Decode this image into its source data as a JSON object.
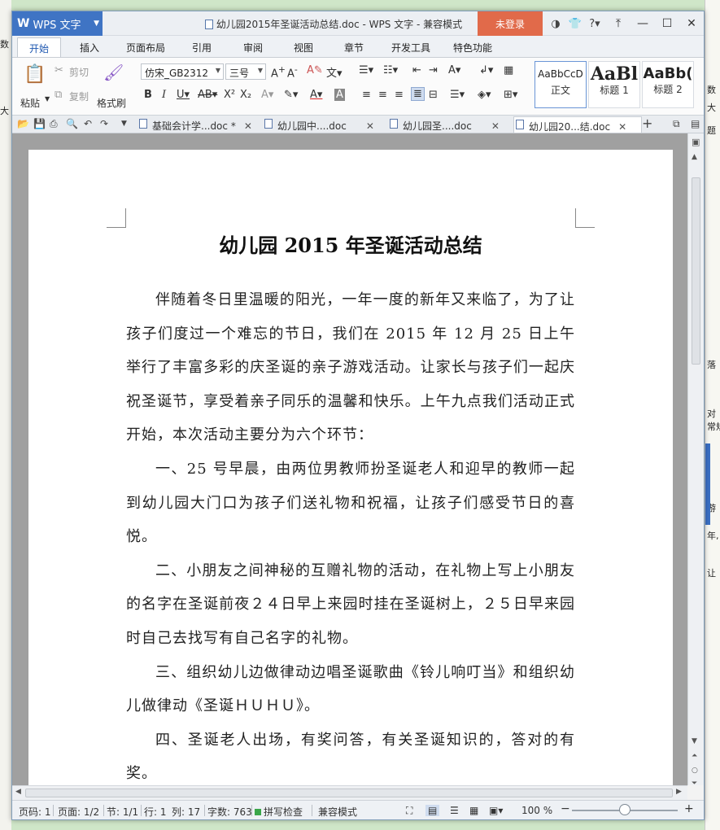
{
  "background": {
    "left_fragments": [
      "数",
      "大"
    ],
    "right_fragments": [
      "数",
      "大",
      "题",
      "落",
      "对",
      "常规",
      "游",
      "年,",
      "让"
    ]
  },
  "titlebar": {
    "app_name": "WPS 文字",
    "title": "幼儿园2015年圣诞活动总结.doc - WPS 文字 - 兼容模式",
    "login_label": "未登录"
  },
  "menu": {
    "tabs": [
      "开始",
      "插入",
      "页面布局",
      "引用",
      "审阅",
      "视图",
      "章节",
      "开发工具",
      "特色功能"
    ],
    "active": "开始"
  },
  "ribbon": {
    "paste": "粘贴",
    "cut": "剪切",
    "copy": "复制",
    "format_painter": "格式刷",
    "font_name": "仿宋_GB2312",
    "font_size": "三号",
    "styles": [
      {
        "preview": "AaBbCcD",
        "name": "正文"
      },
      {
        "preview": "AaBl",
        "name": "标题 1"
      },
      {
        "preview": "AaBb(",
        "name": "标题 2"
      }
    ]
  },
  "doc_tabs": [
    {
      "label": "基础会计学...doc *",
      "active": false
    },
    {
      "label": "幼儿园中....doc",
      "active": false
    },
    {
      "label": "幼儿园圣....doc",
      "active": false
    },
    {
      "label": "幼儿园20...结.doc",
      "active": true
    }
  ],
  "document": {
    "title": "幼儿园 2015 年圣诞活动总结",
    "paragraphs": [
      "伴随着冬日里温暖的阳光，一年一度的新年又来临了，为了让孩子们度过一个难忘的节日，我们在 2015 年 12 月 25 日上午举行了丰富多彩的庆圣诞的亲子游戏活动。让家长与孩子们一起庆祝圣诞节，享受着亲子同乐的温馨和快乐。上午九点我们活动正式开始，本次活动主要分为六个环节：",
      "一、25 号早晨，由两位男教师扮圣诞老人和迎早的教师一起到幼儿园大门口为孩子们送礼物和祝福，让孩子们感受节日的喜悦。",
      "二、小朋友之间神秘的互赠礼物的活动，在礼物上写上小朋友的名字在圣诞前夜２４日早上来园时挂在圣诞树上，２５日早来园时自己去找写有自己名字的礼物。",
      "三、组织幼儿边做律动边唱圣诞歌曲《铃儿响叮当》和组织幼儿做律动《圣诞ＨＵＨＵ》。",
      "四、圣诞老人出场，有奖问答，有关圣诞知识的，答对的有奖。"
    ]
  },
  "status": {
    "page_code": "页码: 1",
    "pages": "页面: 1/2",
    "section": "节: 1/1",
    "row": "行: 1",
    "col": "列: 17",
    "words": "字数: 763",
    "spell": "拼写检查",
    "compat": "兼容模式",
    "zoom": "100 %"
  }
}
